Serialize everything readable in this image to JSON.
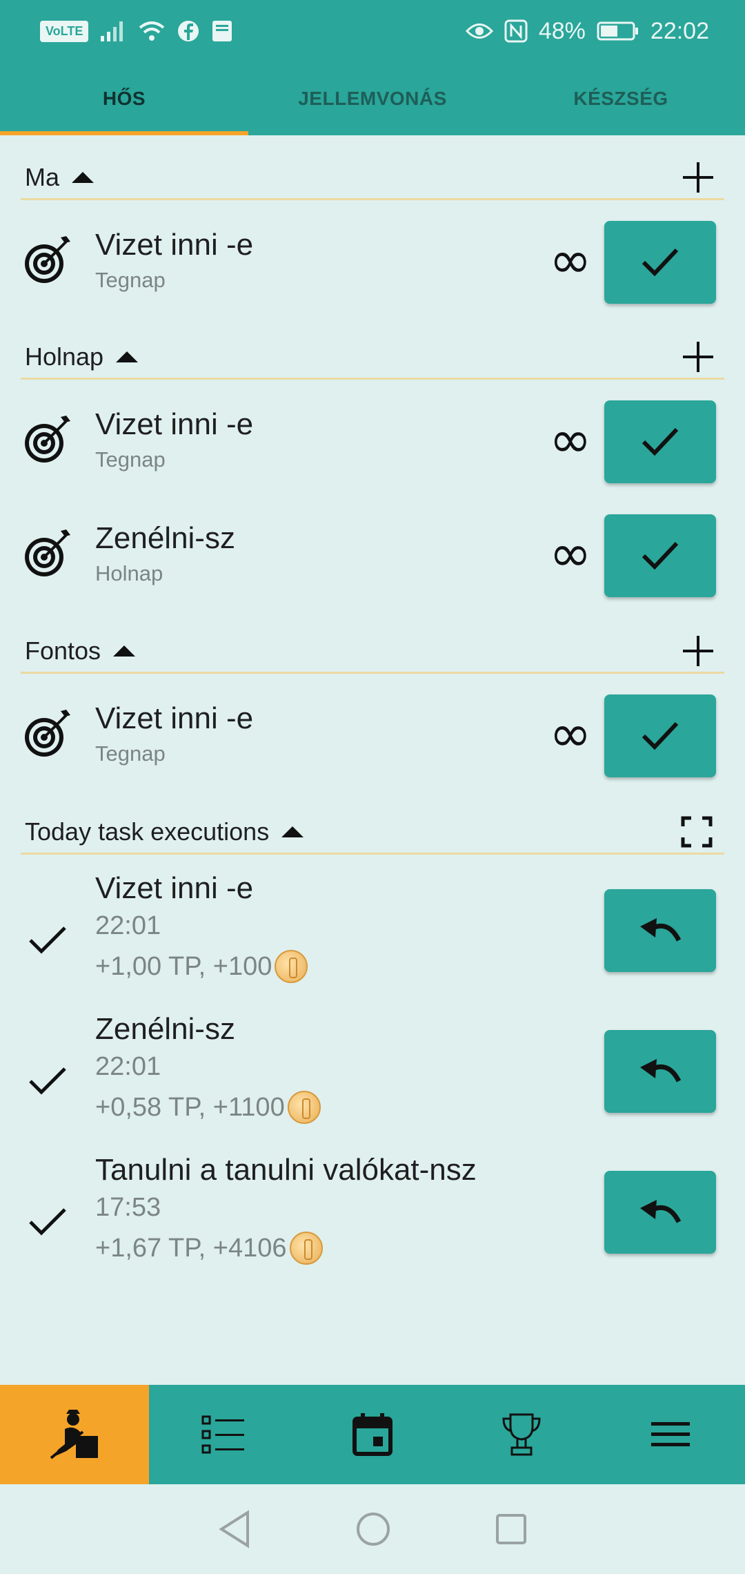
{
  "status_bar": {
    "volte": "VoLTE",
    "battery": "48%",
    "time": "22:02"
  },
  "tabs": [
    {
      "label": "HŐS",
      "active": true
    },
    {
      "label": "JELLEMVONÁS",
      "active": false
    },
    {
      "label": "KÉSZSÉG",
      "active": false
    }
  ],
  "sections": {
    "today": {
      "title": "Ma",
      "tasks": [
        {
          "title": "Vizet inni -e",
          "subtitle": "Tegnap",
          "repeat": "∞"
        }
      ]
    },
    "tomorrow": {
      "title": "Holnap",
      "tasks": [
        {
          "title": "Vizet inni -e",
          "subtitle": "Tegnap",
          "repeat": "∞"
        },
        {
          "title": "Zenélni-sz",
          "subtitle": "Holnap",
          "repeat": "∞"
        }
      ]
    },
    "important": {
      "title": "Fontos",
      "tasks": [
        {
          "title": "Vizet inni -e",
          "subtitle": "Tegnap",
          "repeat": "∞"
        }
      ]
    },
    "executions": {
      "title": "Today task executions",
      "items": [
        {
          "title": "Vizet inni -e",
          "time": "22:01",
          "reward": "+1,00 TP, +100"
        },
        {
          "title": "Zenélni-sz",
          "time": "22:01",
          "reward": "+0,58 TP, +1100"
        },
        {
          "title": "Tanulni a tanulni valókat-nsz",
          "time": "17:53",
          "reward": "+1,67 TP, +4106"
        }
      ]
    }
  },
  "bottom_nav": [
    {
      "icon": "hero-icon",
      "active": true
    },
    {
      "icon": "task-list-icon",
      "active": false
    },
    {
      "icon": "calendar-icon",
      "active": false
    },
    {
      "icon": "trophy-icon",
      "active": false
    },
    {
      "icon": "menu-icon",
      "active": false
    }
  ],
  "colors": {
    "primary": "#2aa69a",
    "accent": "#f5a42a",
    "background": "#dff0ef",
    "divider": "#ecd9a0"
  }
}
